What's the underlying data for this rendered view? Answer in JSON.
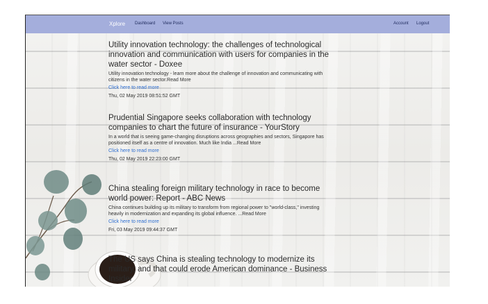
{
  "navbar": {
    "brand": "Xplore",
    "links": [
      "Dashboard",
      "View Posts"
    ],
    "right_links": [
      "Account",
      "Logout"
    ],
    "color": "#a4aedc"
  },
  "articles": [
    {
      "title": "Utility innovation technology: the challenges of technological innovation and communication with users for companies in the water sector - Doxee",
      "summary": "Utility innovation technology - learn more about the challenge of innovation and communicating with citizens in the water sector.Read More",
      "link": "Click here to read more",
      "date": "Thu, 02 May 2019 08:51:52 GMT"
    },
    {
      "title": "Prudential Singapore seeks collaboration with technology companies to chart the future of insurance - YourStory",
      "summary": "In a world that is seeing game-changing disruptions across geographies and sectors, Singapore has positioned itself as a centre of innovation. Much like India ...Read More",
      "link": "Click here to read more",
      "date": "Thu, 02 May 2019 22:23:00 GMT"
    },
    {
      "title": "China stealing foreign military technology in race to become world power: Report - ABC News",
      "summary": "China continues building up its military to transform from regional power to \"world-class,\" investing heavily in modernization and expanding its global influence. ...Read More",
      "link": "Click here to read more",
      "date": "Fri, 03 May 2019 09:44:37 GMT"
    },
    {
      "title": "The US says China is stealing technology to modernize its military, and that could erode American dominance - Business Insider"
    }
  ],
  "icons": [
    "eucalyptus-decoration",
    "coffee-cup-decoration"
  ],
  "link_color": "#2f6fd1"
}
